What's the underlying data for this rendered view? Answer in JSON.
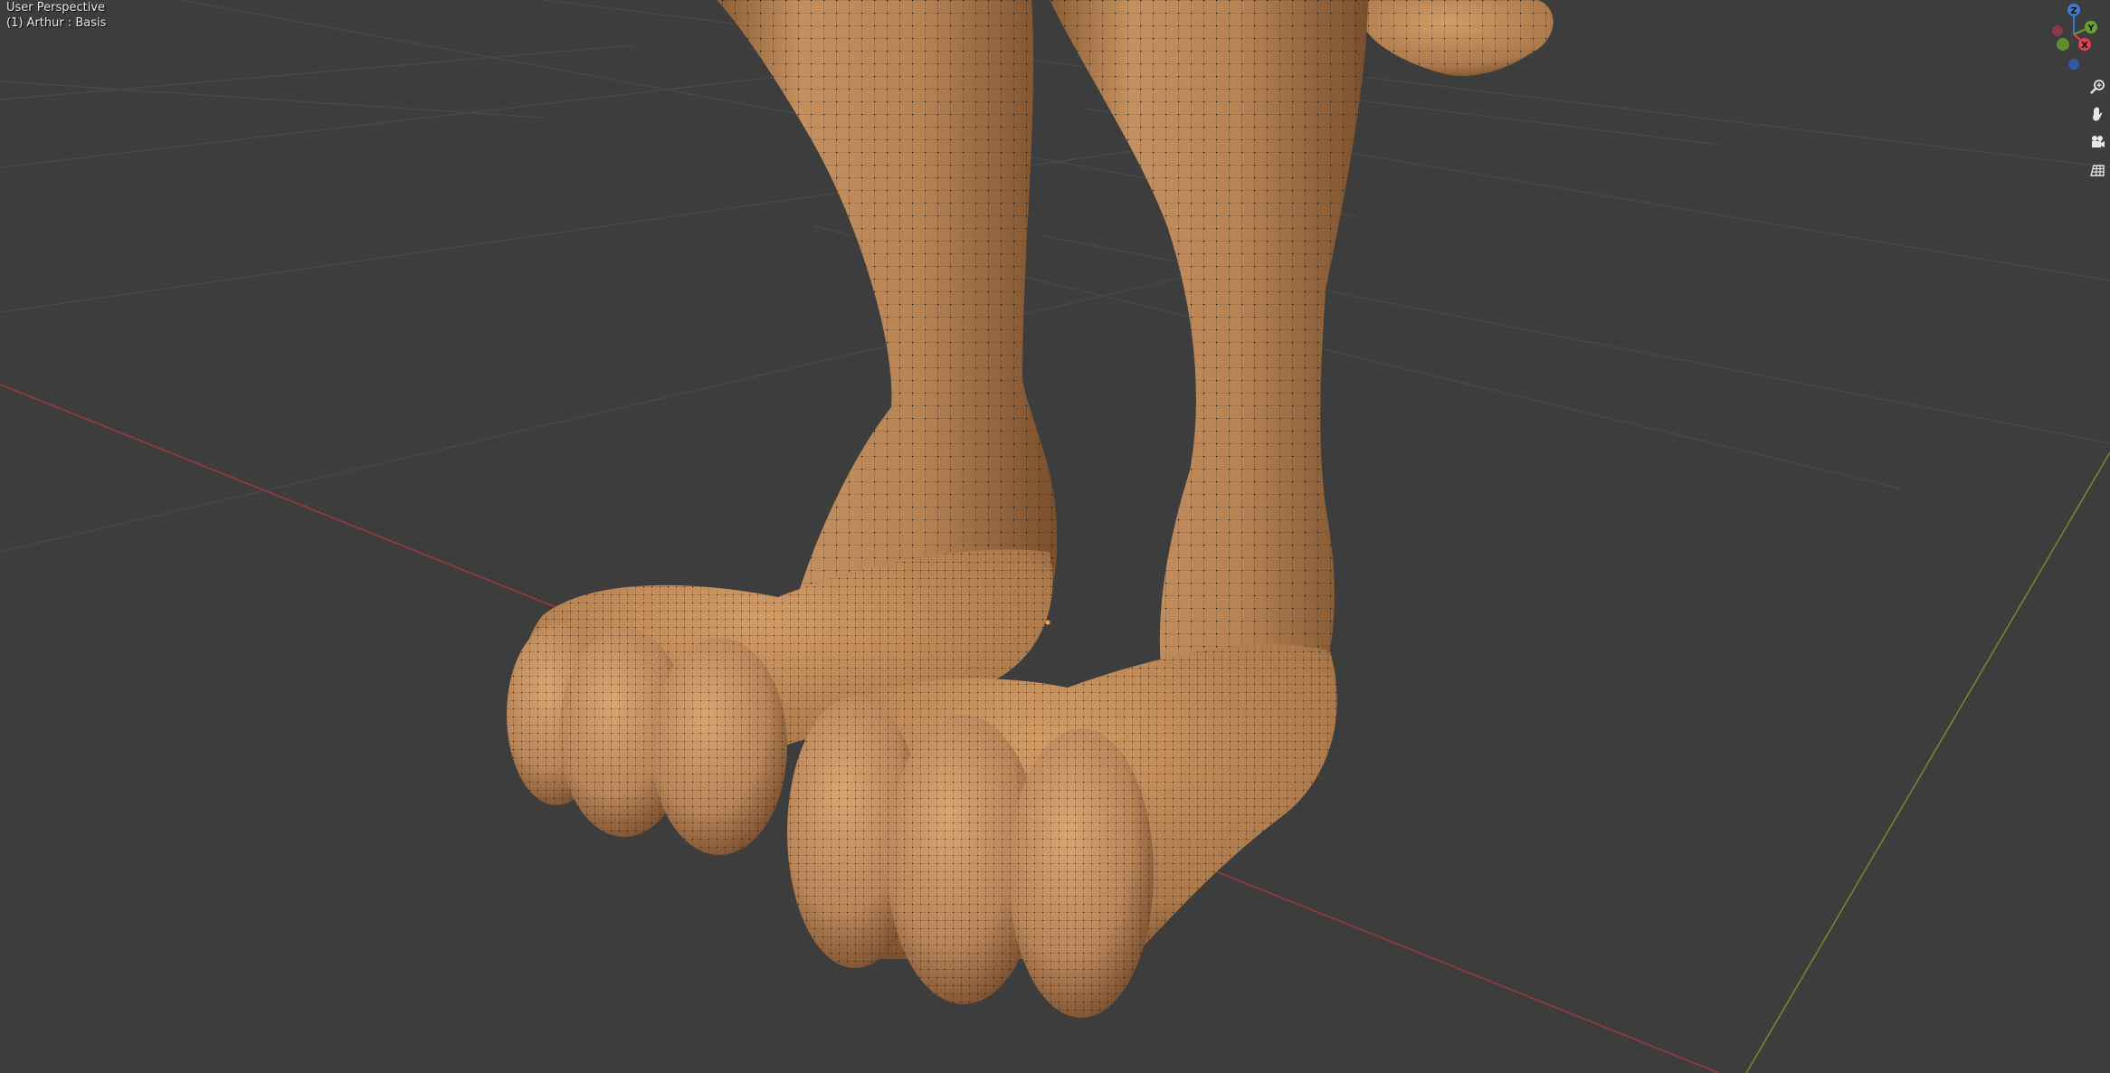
{
  "viewport": {
    "view_name": "User Perspective",
    "object_info": "(1) Arthur : Basis"
  },
  "gizmo": {
    "axis_z_label": "Z",
    "axis_y_label": "Y",
    "axis_x_label": "X",
    "colors": {
      "x": "#e0414d",
      "y": "#67a42f",
      "z": "#3c7ad0"
    }
  },
  "nav_buttons": [
    {
      "name": "zoom",
      "icon": "magnifier-icon"
    },
    {
      "name": "pan",
      "icon": "hand-icon"
    },
    {
      "name": "camera",
      "icon": "camera-icon"
    },
    {
      "name": "ortho",
      "icon": "grid-icon"
    }
  ],
  "colors": {
    "background": "#3d3d3d",
    "grid": "#4a4a4a",
    "x_axis": "#9c3940",
    "y_axis": "#6c8b2c",
    "mesh": "#c8915e",
    "wire": "#1a1008"
  }
}
